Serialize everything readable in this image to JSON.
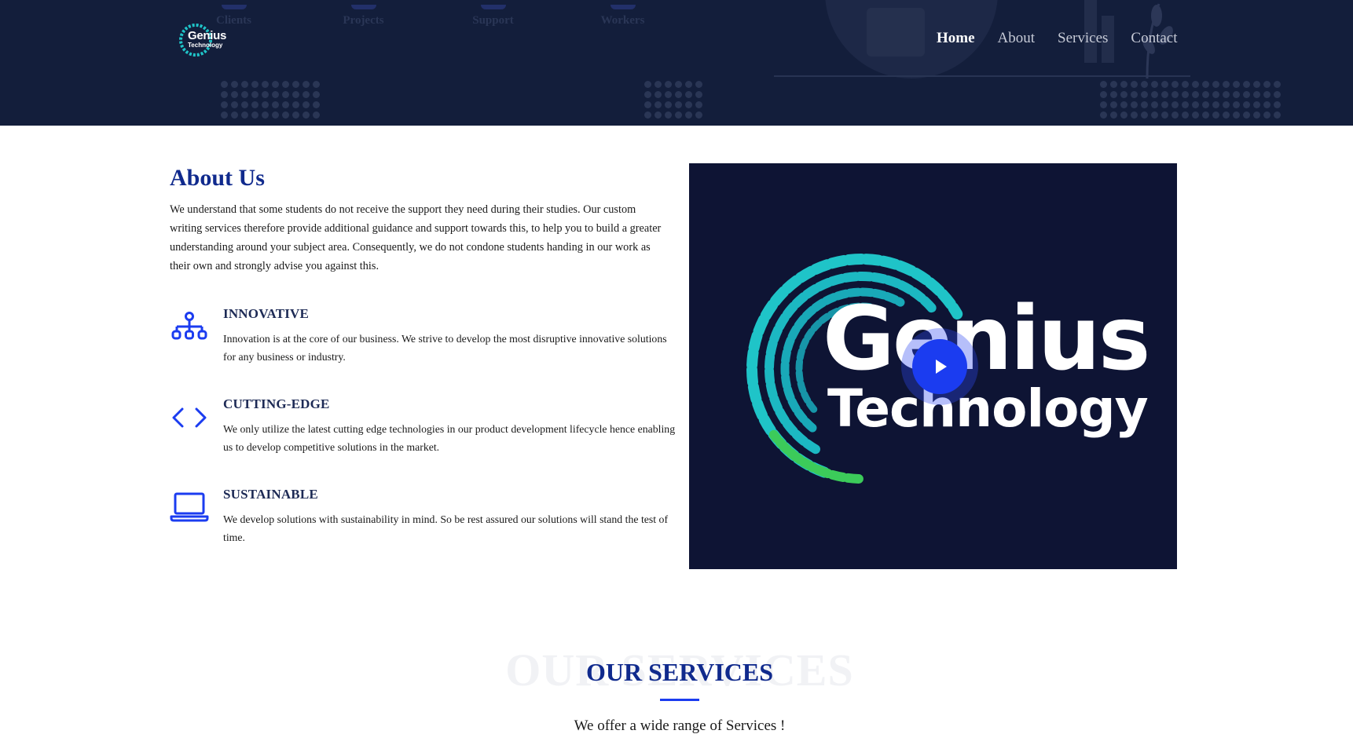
{
  "header": {
    "logo": {
      "line1": "Genius",
      "line2": "Technology"
    },
    "ghost_stats": [
      "Clients",
      "Projects",
      "Support",
      "Workers"
    ],
    "nav": [
      {
        "label": "Home",
        "active": true
      },
      {
        "label": "About",
        "active": false
      },
      {
        "label": "Services",
        "active": false
      },
      {
        "label": "Contact",
        "active": false
      }
    ]
  },
  "about": {
    "title": "About Us",
    "paragraph": "We understand that some students do not receive the support they need during their studies. Our custom writing services therefore provide additional guidance and support towards this, to help you to build a greater understanding around your subject area. Consequently, we do not condone students handing in our work as their own and strongly advise you against this.",
    "features": [
      {
        "icon": "sitemap-icon",
        "title": "INNOVATIVE",
        "description": "Innovation is at the core of our business. We strive to develop the most disruptive innovative solutions for any business or industry."
      },
      {
        "icon": "code-icon",
        "title": "CUTTING-EDGE",
        "description": "We only utilize the latest cutting edge technologies in our product development lifecycle hence enabling us to develop competitive solutions in the market."
      },
      {
        "icon": "laptop-icon",
        "title": "SUSTAINABLE",
        "description": "We develop solutions with sustainability in mind. So be rest assured our solutions will stand the test of time."
      }
    ]
  },
  "video": {
    "title_line1": "Genius",
    "title_line2": "Technology"
  },
  "services": {
    "ghost": "OUR SERVICES",
    "title": "OUR SERVICES",
    "subtitle": "We offer a wide range of Services !"
  },
  "colors": {
    "header_bg": "#131e3b",
    "accent": "#1b3cf0",
    "title": "#102a8d",
    "video_bg": "#0e1434",
    "teal": "#1fc4c8"
  }
}
